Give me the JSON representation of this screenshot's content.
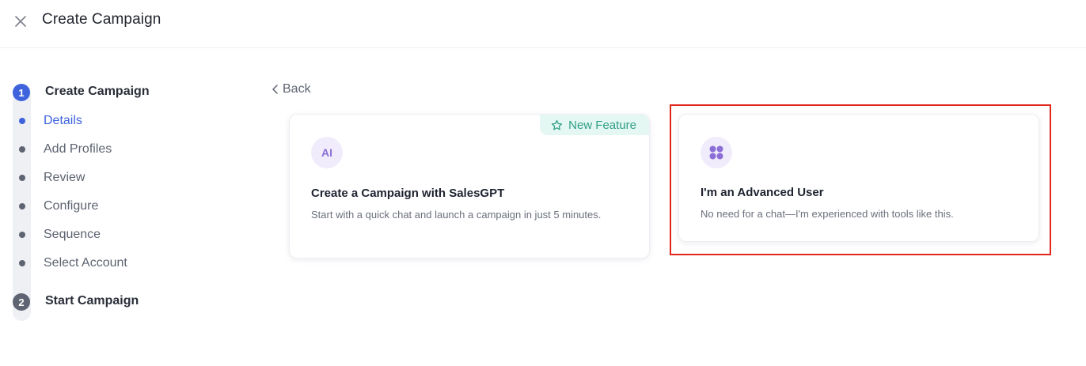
{
  "header": {
    "title": "Create Campaign",
    "close_icon": "close-icon"
  },
  "stepper": {
    "steps": [
      {
        "number": "1",
        "title": "Create Campaign",
        "state": "active"
      },
      {
        "number": "2",
        "title": "Start Campaign",
        "state": "inactive"
      }
    ],
    "substeps": [
      {
        "label": "Details",
        "state": "active"
      },
      {
        "label": "Add Profiles",
        "state": "inactive"
      },
      {
        "label": "Review",
        "state": "inactive"
      },
      {
        "label": "Configure",
        "state": "inactive"
      },
      {
        "label": "Sequence",
        "state": "inactive"
      },
      {
        "label": "Select Account",
        "state": "inactive"
      }
    ]
  },
  "back": {
    "label": "Back",
    "icon": "chevron-left-icon"
  },
  "cards": [
    {
      "badge": "New Feature",
      "badge_icon": "star-icon",
      "icon_text": "AI",
      "title": "Create a Campaign with SalesGPT",
      "description": "Start with a quick chat and launch a campaign in just 5 minutes."
    },
    {
      "icon": "grid-icon",
      "title": "I'm an Advanced User",
      "description": "No need for a chat—I'm experienced with tools like this."
    }
  ],
  "colors": {
    "accent": "#3e63dd",
    "badge_bg": "#e5f7f3",
    "badge_text": "#2e9e86",
    "icon_purple": "#8b6fd6",
    "highlight": "#e0271b"
  }
}
